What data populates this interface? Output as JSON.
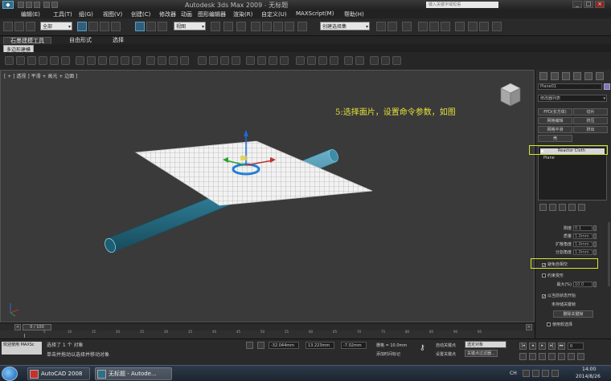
{
  "window": {
    "title_prefix": "Autodesk 3ds Max 2009",
    "title_suffix": "无标题",
    "search_placeholder": "键入关键字或短语",
    "min": "_",
    "max": "□",
    "close": "×"
  },
  "menu": [
    "编辑(E)",
    "工具(T)",
    "组(G)",
    "视图(V)",
    "创建(C)",
    "修改器",
    "动画",
    "图形编辑器",
    "渲染(R)",
    "自定义(U)",
    "MAXScript(M)",
    "帮助(H)"
  ],
  "toolbar": {
    "selection_filter": "全部",
    "ref_coord": "视图",
    "named_selection": "创建选择集"
  },
  "ribbon": {
    "tabs": [
      "石墨建模工具",
      "自由形式",
      "选择"
    ],
    "sub_label": "多边形建模"
  },
  "viewport": {
    "label": "[ + ] 透视 ] 平滑 + 高光 + 边面 ]",
    "annotation": "5:选择面片，设置命令参数，如图"
  },
  "command_panel": {
    "object_name": "Plane01",
    "color": "#7a73c9",
    "modifier_list": "修改器列表",
    "buttons": [
      "FFD(长方体)",
      "切片",
      "网格编辑",
      "挤压",
      "网格平滑",
      "挤出",
      "壳"
    ],
    "stack": [
      "Reactor Cloth",
      "Plane"
    ],
    "params": [
      {
        "label": "刚度",
        "value": "0.1"
      },
      {
        "label": "质量",
        "value": "1.0mm"
      },
      {
        "label": "扩散角度",
        "value": "1.0mm"
      },
      {
        "label": "分割角度",
        "value": "1.0mm"
      }
    ],
    "avoid_self_intersect": "避免自相交",
    "constrain_deformation": "约束变形",
    "max_label": "最大(%)",
    "max_value": "10.0",
    "checkbox_3": "以当前状态开始",
    "action_label": "未存储关键帧",
    "action_button": "删除关键帧",
    "checkbox_4": "使用软选择"
  },
  "timeline": {
    "range": "0 / 100",
    "prev": "<",
    "next": ">",
    "ticks": [
      "5",
      "10",
      "15",
      "20",
      "25",
      "30",
      "35",
      "40",
      "45",
      "50",
      "55",
      "60",
      "65",
      "70",
      "75",
      "80",
      "85",
      "90",
      "95"
    ]
  },
  "status": {
    "maxscript_line1": "欢迎使用 MAXSc",
    "maxscript_line2": "",
    "selected": "选择了 1 个 对象",
    "hint": "单击并拖动以选择并移动对象",
    "x_value": "-32.044mm",
    "y_value": "13.223mm",
    "z_value": "-7.02mm",
    "grid": "栅格 = 10.0mm",
    "add_time_tag": "添加时间标记",
    "auto_key": "自动关键点",
    "auto_key_value": "选定对象",
    "set_key": "设置关键点",
    "key_filters": "关键点过滤器...",
    "frame": "0"
  },
  "taskbar": {
    "items": [
      "AutoCAD 2008",
      "无标题 - Autode..."
    ],
    "lang": "CH",
    "time": "14:00",
    "date": "2014/8/26"
  }
}
